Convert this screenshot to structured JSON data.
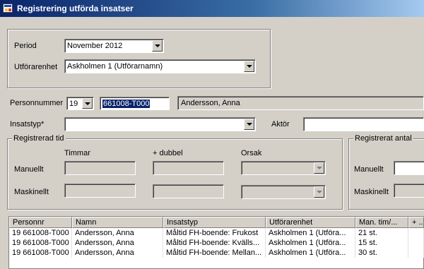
{
  "window": {
    "title": "Registrering utförda insatser"
  },
  "filters": {
    "period_label": "Period",
    "period_value": "November 2012",
    "utforarenhet_label": "Utförarenhet",
    "utforarenhet_value": "Askholmen 1 (Utförarnamn)"
  },
  "person": {
    "label": "Personnummer",
    "century": "19",
    "number": "661008-T000",
    "name": "Andersson, Anna"
  },
  "insats": {
    "label": "Insatstyp*",
    "value": "",
    "aktor_label": "Aktör",
    "aktor_value": ""
  },
  "registrerad_tid": {
    "title": "Registrerad tid",
    "col_timmar": "Timmar",
    "col_dubbel": "+ dubbel",
    "col_orsak": "Orsak",
    "row_manuellt": "Manuellt",
    "row_maskinellt": "Maskinellt"
  },
  "registrerat_antal": {
    "title": "Registrerat antal",
    "row_manuellt": "Manuellt",
    "row_maskinellt": "Maskinellt"
  },
  "grid": {
    "columns": [
      "Personnr",
      "Namn",
      "Insatstyp",
      "Utförarenhet",
      "Man. tim/...",
      "+ ..."
    ],
    "rows": [
      [
        "19 661008-T000",
        "Andersson, Anna",
        "Måltid FH-boende: Frukost",
        "Askholmen 1 (Utföra...",
        "21 st.",
        ""
      ],
      [
        "19 661008-T000",
        "Andersson, Anna",
        "Måltid FH-boende: Kvälls...",
        "Askholmen 1 (Utföra...",
        "15 st.",
        ""
      ],
      [
        "19 661008-T000",
        "Andersson, Anna",
        "Måltid FH-boende: Mellan...",
        "Askholmen 1 (Utföra...",
        "30 st.",
        ""
      ]
    ]
  }
}
